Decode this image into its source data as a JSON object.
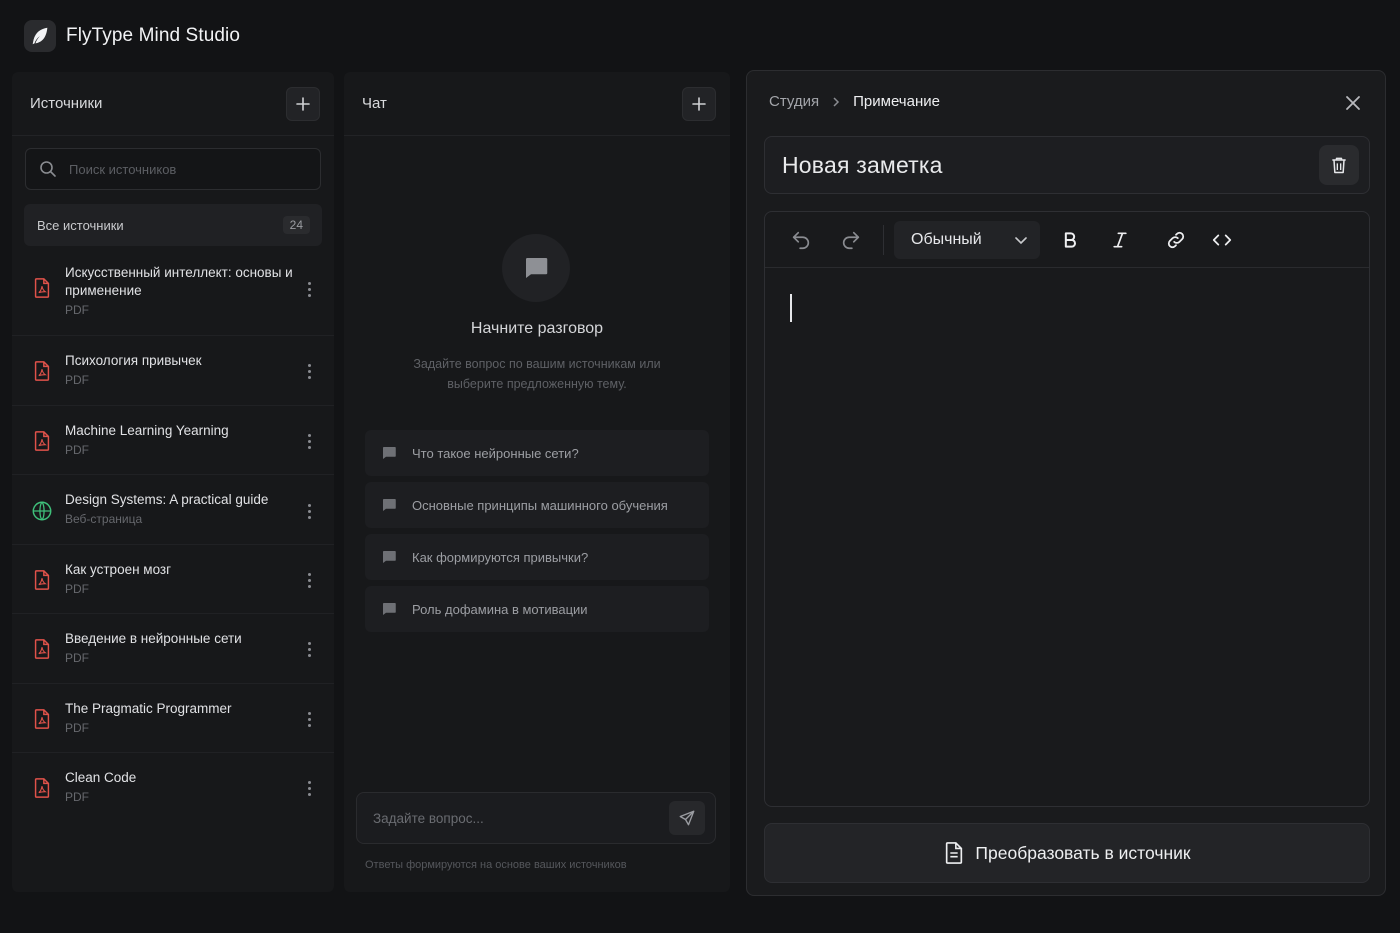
{
  "app": {
    "title": "FlyType Mind Studio"
  },
  "sources": {
    "title": "Источники",
    "search_placeholder": "Поиск источников",
    "all_label": "Все источники",
    "count": "24",
    "items": [
      {
        "title": "Искусственный интеллект: основы и применение",
        "type": "PDF",
        "icon": "pdf-icon"
      },
      {
        "title": "Психология привычек",
        "type": "PDF",
        "icon": "pdf-icon"
      },
      {
        "title": "Machine Learning Yearning",
        "type": "PDF",
        "icon": "pdf-icon"
      },
      {
        "title": "Design Systems: A practical guide",
        "type": "Веб-страница",
        "icon": "globe-icon"
      },
      {
        "title": "Как устроен мозг",
        "type": "PDF",
        "icon": "pdf-icon"
      },
      {
        "title": "Введение в нейронные сети",
        "type": "PDF",
        "icon": "pdf-icon"
      },
      {
        "title": "The Pragmatic Programmer",
        "type": "PDF",
        "icon": "pdf-icon"
      },
      {
        "title": "Clean Code",
        "type": "PDF",
        "icon": "pdf-icon"
      }
    ]
  },
  "chat": {
    "title": "Чат",
    "empty_title": "Начните разговор",
    "empty_subtitle": "Задайте вопрос по вашим источникам или выберите предложенную тему.",
    "suggestions": [
      "Что такое нейронные сети?",
      "Основные принципы машинного обучения",
      "Как формируются привычки?",
      "Роль дофамина в мотивации"
    ],
    "input_placeholder": "Задайте вопрос...",
    "footnote": "Ответы формируются на основе ваших источников"
  },
  "studio": {
    "breadcrumb": [
      "Студия",
      "Примечание"
    ],
    "note_title": "Новая заметка",
    "format_select": "Обычный",
    "convert_label": "Преобразовать в источник"
  },
  "colors": {
    "background": "#121315",
    "panel": "#17181a",
    "pdf_icon": "#e0524a",
    "web_icon": "#3fbf7a"
  }
}
